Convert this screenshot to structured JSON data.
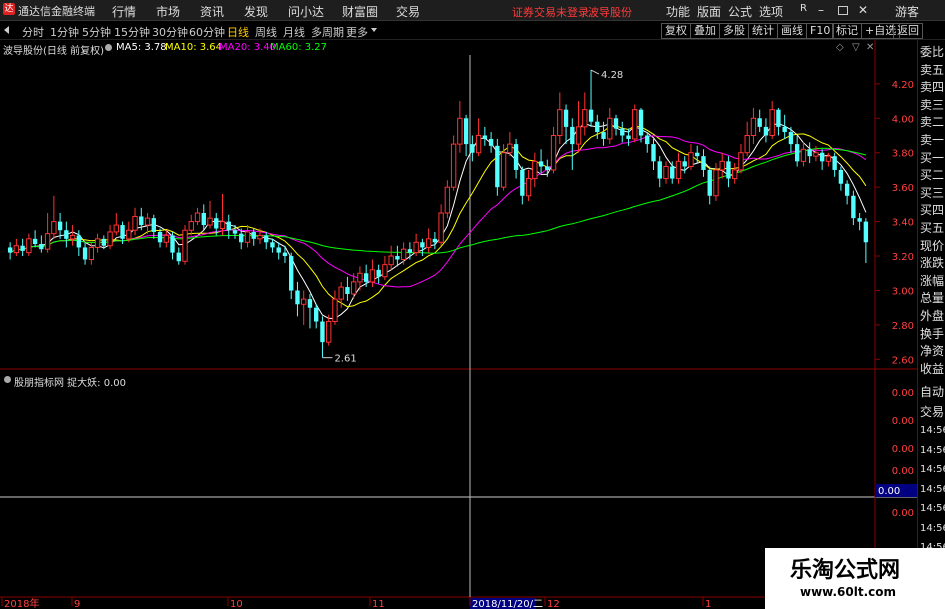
{
  "app": {
    "logo": "达",
    "name": "通达信金融终端"
  },
  "menu": [
    "行情",
    "市场",
    "资讯",
    "发现",
    "问小达",
    "财富圈",
    "交易"
  ],
  "status_notice": "证券交易未登录",
  "stock_name_top": "波导股份",
  "top_right_menu": [
    "功能",
    "版面",
    "公式",
    "选项"
  ],
  "top_right_icons": [
    "R-icon",
    "minimize-icon",
    "restore-icon",
    "close-icon"
  ],
  "guest_label": "游客",
  "period_tabs": [
    "分时",
    "1分钟",
    "5分钟",
    "15分钟",
    "30分钟",
    "60分钟",
    "日线",
    "周线",
    "月线",
    "多周期",
    "更多"
  ],
  "active_period": "日线",
  "right_tools": [
    "复权",
    "叠加",
    "多股",
    "统计",
    "画线",
    "F10",
    "标记",
    "+自选",
    "返回"
  ],
  "chart_title": "波导股份(日线 前复权)",
  "ma": {
    "ma5_label": "MA5: 3.78",
    "ma10_label": "MA10: 3.64",
    "ma20_label": "MA20: 3.40",
    "ma60_label": "MA60: 3.27",
    "ma5_color": "#ffffff",
    "ma10_color": "#ffff00",
    "ma20_color": "#ff00ff",
    "ma60_color": "#00ff00"
  },
  "price_axis": [
    "4.20",
    "4.00",
    "3.80",
    "3.60",
    "3.40",
    "3.20",
    "3.00",
    "2.80",
    "2.60"
  ],
  "high_label": "4.28",
  "low_label": "2.61",
  "indicator_title": "股朋指标网  捉大妖: 0.00",
  "indicator_axis": [
    "0.00",
    "0.00",
    "0.00",
    "0.00",
    "0.00"
  ],
  "indicator_current": "0.00",
  "right_panel": [
    "委比",
    "卖五",
    "卖四",
    "卖三",
    "卖二",
    "卖一",
    "买一",
    "买二",
    "买三",
    "买四",
    "买五",
    "现价",
    "涨跌",
    "涨幅",
    "总量",
    "外盘",
    "换手",
    "净资",
    "收益"
  ],
  "right_panel_lower": [
    "自动",
    "交易",
    "14:56",
    "14:56",
    "14:56",
    "14:56",
    "14:56",
    "14:56",
    "14:56"
  ],
  "date_axis": [
    "2018年",
    "9",
    "10",
    "11",
    "2018/11/20/二",
    "12",
    "1"
  ],
  "watermark": {
    "title": "乐淘公式网",
    "url": "www.60lt.com"
  },
  "chart_data": {
    "type": "candlestick",
    "title": "波导股份(日线 前复权)",
    "ylim": [
      2.55,
      4.35
    ],
    "yticks": [
      4.2,
      4.0,
      3.8,
      3.6,
      3.4,
      3.2,
      3.0,
      2.8,
      2.6
    ],
    "high": 4.28,
    "low": 2.61,
    "candles": [
      [
        3.25,
        3.22,
        3.28,
        3.18
      ],
      [
        3.22,
        3.26,
        3.3,
        3.2
      ],
      [
        3.26,
        3.23,
        3.3,
        3.2
      ],
      [
        3.22,
        3.3,
        3.33,
        3.2
      ],
      [
        3.3,
        3.27,
        3.35,
        3.25
      ],
      [
        3.27,
        3.24,
        3.32,
        3.22
      ],
      [
        3.24,
        3.33,
        3.45,
        3.22
      ],
      [
        3.33,
        3.4,
        3.55,
        3.3
      ],
      [
        3.4,
        3.35,
        3.45,
        3.3
      ],
      [
        3.35,
        3.3,
        3.4,
        3.25
      ],
      [
        3.3,
        3.32,
        3.38,
        3.26
      ],
      [
        3.32,
        3.25,
        3.35,
        3.2
      ],
      [
        3.25,
        3.18,
        3.28,
        3.15
      ],
      [
        3.18,
        3.25,
        3.28,
        3.15
      ],
      [
        3.25,
        3.3,
        3.33,
        3.22
      ],
      [
        3.3,
        3.26,
        3.32,
        3.24
      ],
      [
        3.26,
        3.34,
        3.38,
        3.24
      ],
      [
        3.34,
        3.38,
        3.45,
        3.32
      ],
      [
        3.38,
        3.3,
        3.4,
        3.27
      ],
      [
        3.3,
        3.35,
        3.4,
        3.28
      ],
      [
        3.35,
        3.43,
        3.48,
        3.32
      ],
      [
        3.43,
        3.38,
        3.48,
        3.35
      ],
      [
        3.38,
        3.42,
        3.45,
        3.33
      ],
      [
        3.42,
        3.34,
        3.44,
        3.3
      ],
      [
        3.34,
        3.28,
        3.36,
        3.25
      ],
      [
        3.28,
        3.32,
        3.35,
        3.25
      ],
      [
        3.32,
        3.22,
        3.34,
        3.18
      ],
      [
        3.22,
        3.17,
        3.25,
        3.15
      ],
      [
        3.17,
        3.35,
        3.38,
        3.15
      ],
      [
        3.35,
        3.4,
        3.44,
        3.32
      ],
      [
        3.4,
        3.45,
        3.48,
        3.38
      ],
      [
        3.45,
        3.38,
        3.5,
        3.35
      ],
      [
        3.38,
        3.42,
        3.52,
        3.36
      ],
      [
        3.42,
        3.36,
        3.45,
        3.32
      ],
      [
        3.36,
        3.4,
        3.56,
        3.32
      ],
      [
        3.4,
        3.35,
        3.44,
        3.3
      ],
      [
        3.35,
        3.33,
        3.38,
        3.3
      ],
      [
        3.33,
        3.28,
        3.36,
        3.24
      ],
      [
        3.28,
        3.34,
        3.38,
        3.25
      ],
      [
        3.34,
        3.3,
        3.36,
        3.26
      ],
      [
        3.3,
        3.32,
        3.36,
        3.27
      ],
      [
        3.32,
        3.28,
        3.34,
        3.24
      ],
      [
        3.28,
        3.25,
        3.3,
        3.22
      ],
      [
        3.25,
        3.22,
        3.28,
        3.18
      ],
      [
        3.22,
        3.2,
        3.26,
        3.16
      ],
      [
        3.2,
        3.0,
        3.22,
        2.95
      ],
      [
        3.0,
        2.92,
        3.05,
        2.85
      ],
      [
        2.92,
        2.95,
        3.0,
        2.8
      ],
      [
        2.95,
        2.9,
        2.98,
        2.78
      ],
      [
        2.9,
        2.82,
        2.92,
        2.78
      ],
      [
        2.82,
        2.7,
        2.85,
        2.61
      ],
      [
        2.7,
        2.82,
        2.86,
        2.68
      ],
      [
        2.82,
        2.95,
        3.0,
        2.8
      ],
      [
        2.95,
        3.02,
        3.05,
        2.9
      ],
      [
        3.02,
        2.98,
        3.08,
        2.94
      ],
      [
        2.98,
        3.05,
        3.1,
        2.95
      ],
      [
        3.05,
        3.1,
        3.14,
        3.0
      ],
      [
        3.1,
        3.05,
        3.15,
        3.02
      ],
      [
        3.05,
        3.12,
        3.18,
        3.02
      ],
      [
        3.12,
        3.08,
        3.15,
        3.04
      ],
      [
        3.08,
        3.15,
        3.2,
        3.06
      ],
      [
        3.15,
        3.2,
        3.26,
        3.12
      ],
      [
        3.2,
        3.18,
        3.26,
        3.14
      ],
      [
        3.18,
        3.24,
        3.28,
        3.15
      ],
      [
        3.24,
        3.22,
        3.28,
        3.18
      ],
      [
        3.22,
        3.28,
        3.33,
        3.2
      ],
      [
        3.28,
        3.25,
        3.3,
        3.2
      ],
      [
        3.25,
        3.3,
        3.36,
        3.22
      ],
      [
        3.3,
        3.28,
        3.34,
        3.24
      ],
      [
        3.28,
        3.45,
        3.5,
        3.26
      ],
      [
        3.45,
        3.6,
        3.64,
        3.42
      ],
      [
        3.6,
        3.85,
        3.9,
        3.58
      ],
      [
        3.85,
        4.0,
        4.1,
        3.8
      ],
      [
        4.0,
        3.85,
        4.02,
        3.78
      ],
      [
        3.85,
        3.8,
        3.9,
        3.75
      ],
      [
        3.8,
        3.9,
        4.0,
        3.78
      ],
      [
        3.9,
        3.88,
        3.95,
        3.84
      ],
      [
        3.88,
        3.84,
        3.92,
        3.8
      ],
      [
        3.84,
        3.6,
        3.88,
        3.55
      ],
      [
        3.6,
        3.8,
        3.85,
        3.58
      ],
      [
        3.8,
        3.85,
        3.92,
        3.78
      ],
      [
        3.85,
        3.7,
        3.88,
        3.65
      ],
      [
        3.7,
        3.55,
        3.72,
        3.5
      ],
      [
        3.55,
        3.65,
        3.7,
        3.52
      ],
      [
        3.65,
        3.75,
        3.8,
        3.6
      ],
      [
        3.75,
        3.72,
        3.82,
        3.68
      ],
      [
        3.72,
        3.7,
        3.76,
        3.66
      ],
      [
        3.7,
        3.9,
        3.95,
        3.68
      ],
      [
        3.9,
        4.05,
        4.15,
        3.85
      ],
      [
        4.05,
        3.95,
        4.08,
        3.85
      ],
      [
        3.95,
        3.85,
        4.0,
        3.7
      ],
      [
        3.85,
        3.95,
        4.1,
        3.8
      ],
      [
        3.95,
        4.05,
        4.15,
        3.9
      ],
      [
        4.05,
        3.98,
        4.28,
        3.95
      ],
      [
        3.98,
        3.92,
        4.02,
        3.88
      ],
      [
        3.92,
        3.88,
        3.98,
        3.84
      ],
      [
        3.88,
        4.0,
        4.06,
        3.85
      ],
      [
        4.0,
        3.94,
        4.02,
        3.9
      ],
      [
        3.94,
        3.9,
        3.98,
        3.86
      ],
      [
        3.9,
        3.88,
        3.94,
        3.84
      ],
      [
        3.88,
        4.05,
        4.08,
        3.86
      ],
      [
        4.05,
        3.9,
        4.06,
        3.86
      ],
      [
        3.9,
        3.85,
        3.92,
        3.8
      ],
      [
        3.85,
        3.75,
        3.88,
        3.7
      ],
      [
        3.75,
        3.65,
        3.78,
        3.6
      ],
      [
        3.65,
        3.72,
        3.75,
        3.62
      ],
      [
        3.72,
        3.65,
        3.75,
        3.62
      ],
      [
        3.65,
        3.75,
        3.8,
        3.62
      ],
      [
        3.75,
        3.72,
        3.78,
        3.68
      ],
      [
        3.72,
        3.8,
        3.85,
        3.7
      ],
      [
        3.8,
        3.78,
        3.84,
        3.74
      ],
      [
        3.78,
        3.7,
        3.82,
        3.66
      ],
      [
        3.7,
        3.55,
        3.72,
        3.5
      ],
      [
        3.55,
        3.7,
        3.74,
        3.52
      ],
      [
        3.7,
        3.75,
        3.8,
        3.65
      ],
      [
        3.75,
        3.65,
        3.78,
        3.6
      ],
      [
        3.65,
        3.7,
        3.74,
        3.62
      ],
      [
        3.7,
        3.8,
        3.85,
        3.68
      ],
      [
        3.8,
        3.9,
        3.98,
        3.78
      ],
      [
        3.9,
        4.0,
        4.06,
        3.85
      ],
      [
        4.0,
        3.95,
        4.05,
        3.92
      ],
      [
        3.95,
        3.9,
        4.0,
        3.86
      ],
      [
        3.9,
        4.05,
        4.1,
        3.88
      ],
      [
        4.05,
        3.95,
        4.06,
        3.9
      ],
      [
        3.95,
        3.92,
        4.02,
        3.88
      ],
      [
        3.92,
        3.85,
        3.95,
        3.8
      ],
      [
        3.85,
        3.75,
        3.9,
        3.72
      ],
      [
        3.75,
        3.82,
        3.86,
        3.72
      ],
      [
        3.82,
        3.78,
        3.86,
        3.74
      ],
      [
        3.78,
        3.8,
        3.84,
        3.75
      ],
      [
        3.8,
        3.75,
        3.82,
        3.7
      ],
      [
        3.75,
        3.78,
        3.8,
        3.72
      ],
      [
        3.78,
        3.7,
        3.8,
        3.66
      ],
      [
        3.7,
        3.62,
        3.72,
        3.58
      ],
      [
        3.62,
        3.55,
        3.64,
        3.5
      ],
      [
        3.55,
        3.42,
        3.58,
        3.38
      ],
      [
        3.42,
        3.4,
        3.45,
        3.35
      ],
      [
        3.4,
        3.28,
        3.42,
        3.16
      ]
    ]
  }
}
